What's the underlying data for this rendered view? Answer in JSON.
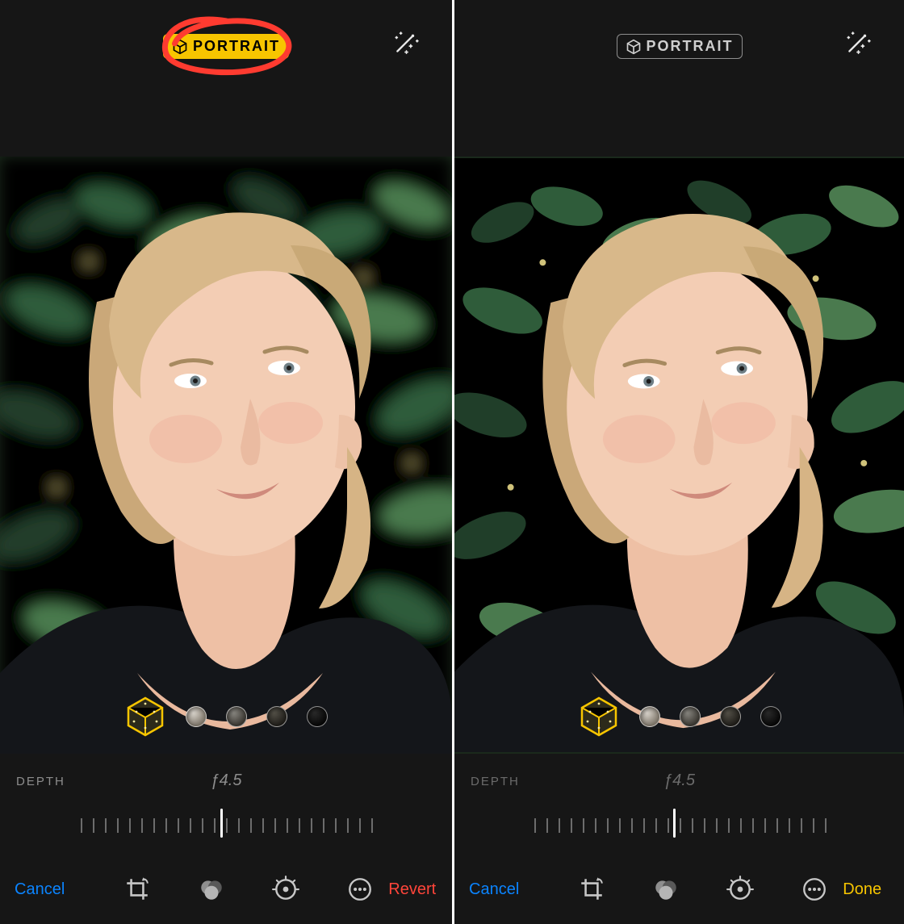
{
  "left": {
    "badge_label": "PORTRAIT",
    "badge_active": true,
    "depth_label": "DEPTH",
    "aperture_value": "ƒ4.5",
    "cancel_label": "Cancel",
    "action_label": "Revert",
    "lighting_options": [
      "natural",
      "studio",
      "contour",
      "stage",
      "stage-mono"
    ],
    "selected_lighting": "natural"
  },
  "right": {
    "badge_label": "PORTRAIT",
    "badge_active": false,
    "depth_label": "DEPTH",
    "aperture_value": "ƒ4.5",
    "cancel_label": "Cancel",
    "action_label": "Done",
    "lighting_options": [
      "natural",
      "studio",
      "contour",
      "stage",
      "stage-mono"
    ],
    "selected_lighting": "natural"
  },
  "annotation": {
    "stroke": "#ff3b30",
    "target": "portrait-badge"
  },
  "colors": {
    "accent_yellow": "#f7c500",
    "accent_blue": "#0b84ff",
    "accent_red": "#ff453a"
  }
}
